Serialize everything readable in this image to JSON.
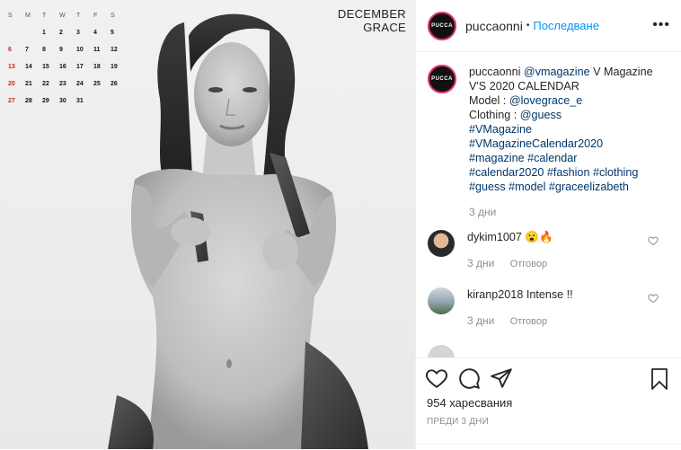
{
  "photo": {
    "calendar": {
      "weekday_headers": [
        "S",
        "M",
        "T",
        "W",
        "T",
        "F",
        "S"
      ],
      "rows": [
        [
          "",
          "",
          "1",
          "2",
          "3",
          "4",
          "5"
        ],
        [
          "6",
          "7",
          "8",
          "9",
          "10",
          "11",
          "12"
        ],
        [
          "13",
          "14",
          "15",
          "16",
          "17",
          "18",
          "19"
        ],
        [
          "20",
          "21",
          "22",
          "23",
          "24",
          "25",
          "26"
        ],
        [
          "27",
          "28",
          "29",
          "30",
          "31",
          "",
          ""
        ]
      ]
    },
    "month_title": "DECEMBER",
    "month_subtitle": "GRACE"
  },
  "header": {
    "avatar_text": "PUCCA",
    "username": "puccaonni",
    "separator": "•",
    "follow_label": "Последване",
    "more_label": "•••"
  },
  "caption": {
    "username": "puccaonni",
    "mention": "@vmagazine",
    "line1_rest": " V Magazine V'S 2020 CALENDAR",
    "model_label": "Model : ",
    "model_mention": "@lovegrace_e",
    "clothing_label": "Clothing : ",
    "clothing_mention": "@guess",
    "tag1": "#VMagazine",
    "tag2": "#VMagazineCalendar2020",
    "tag3": "#magazine #calendar",
    "tag4": "#calendar2020 #fashion #clothing",
    "tag5": "#guess #model #graceelizabeth",
    "time": "3 дни"
  },
  "comments": [
    {
      "username": "dykim1007",
      "text": " 😮🔥",
      "time": "3 дни",
      "reply": "Отговор"
    },
    {
      "username": "kiranp2018",
      "text": " Intense !!",
      "time": "3 дни",
      "reply": "Отговор"
    }
  ],
  "footer": {
    "likes": "954 харесвания",
    "posted_ago": "ПРЕДИ 3 ДНИ"
  },
  "colors": {
    "accent": "#0095f6",
    "link": "#00376b",
    "muted": "#8e8e8e",
    "calendar_red": "#c62828"
  }
}
